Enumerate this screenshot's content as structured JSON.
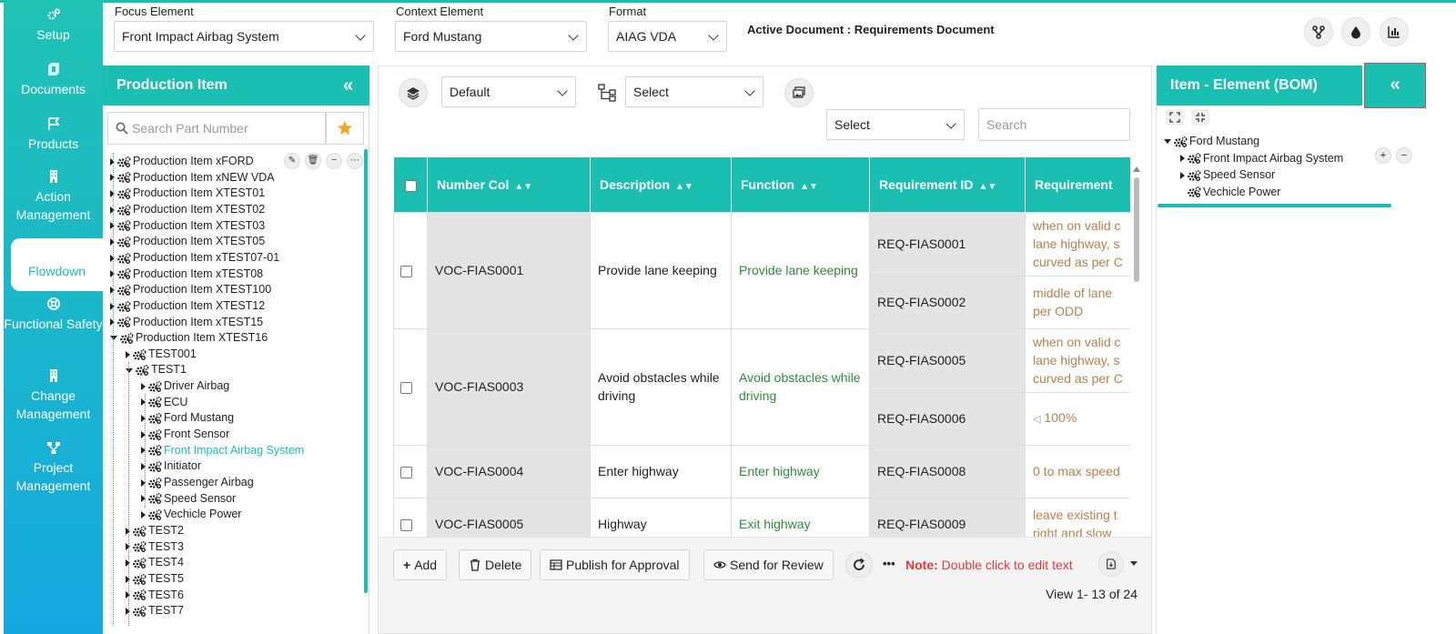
{
  "nav": {
    "items": [
      {
        "label": "Setup",
        "icon": "gears-icon"
      },
      {
        "label": "Documents",
        "icon": "copy-icon"
      },
      {
        "label": "Products",
        "icon": "flag-icon"
      },
      {
        "label": "Action Management",
        "icon": "building-icon"
      },
      {
        "label": "Flowdown",
        "icon": "building-icon",
        "active": true
      },
      {
        "label": "Functional Safety",
        "icon": "life-ring-icon"
      },
      {
        "label": "Change Management",
        "icon": "building-icon"
      },
      {
        "label": "Project Management",
        "icon": "sitemap-icon"
      }
    ]
  },
  "topbar": {
    "focus_label": "Focus Element",
    "focus_value": "Front Impact Airbag System",
    "context_label": "Context Element",
    "context_value": "Ford Mustang",
    "format_label": "Format",
    "format_value": "AIAG VDA",
    "active_document": "Active Document : Requirements Document"
  },
  "production": {
    "title": "Production Item",
    "collapse": "«",
    "search_placeholder": "Search Part Number",
    "tree": [
      {
        "label": "Production Item xFORD",
        "level": 0,
        "open": false
      },
      {
        "label": "Production Item xNEW VDA",
        "level": 0,
        "open": false
      },
      {
        "label": "Production Item XTEST01",
        "level": 0,
        "open": false
      },
      {
        "label": "Production Item XTEST02",
        "level": 0,
        "open": false
      },
      {
        "label": "Production Item XTEST03",
        "level": 0,
        "open": false
      },
      {
        "label": "Production Item XTEST05",
        "level": 0,
        "open": false
      },
      {
        "label": "Production Item xTEST07-01",
        "level": 0,
        "open": false
      },
      {
        "label": "Production Item xTEST08",
        "level": 0,
        "open": false
      },
      {
        "label": "Production Item XTEST100",
        "level": 0,
        "open": false
      },
      {
        "label": "Production Item XTEST12",
        "level": 0,
        "open": false
      },
      {
        "label": "Production Item xTEST15",
        "level": 0,
        "open": false
      },
      {
        "label": "Production Item XTEST16",
        "level": 0,
        "open": true
      },
      {
        "label": "TEST001",
        "level": 1,
        "open": false
      },
      {
        "label": "TEST1",
        "level": 1,
        "open": true
      },
      {
        "label": "Driver Airbag",
        "level": 2,
        "open": false
      },
      {
        "label": "ECU",
        "level": 2,
        "open": false
      },
      {
        "label": "Ford Mustang",
        "level": 2,
        "open": false
      },
      {
        "label": "Front Sensor",
        "level": 2,
        "open": false
      },
      {
        "label": "Front Impact Airbag System",
        "level": 2,
        "open": false,
        "highlight": true
      },
      {
        "label": "Initiator",
        "level": 2,
        "open": false
      },
      {
        "label": "Passenger Airbag",
        "level": 2,
        "open": false
      },
      {
        "label": "Speed Sensor",
        "level": 2,
        "open": false
      },
      {
        "label": "Vechicle Power",
        "level": 2,
        "open": false
      },
      {
        "label": "TEST2",
        "level": 1,
        "open": false
      },
      {
        "label": "TEST3",
        "level": 1,
        "open": false
      },
      {
        "label": "TEST4",
        "level": 1,
        "open": false
      },
      {
        "label": "TEST5",
        "level": 1,
        "open": false
      },
      {
        "label": "TEST6",
        "level": 1,
        "open": false
      },
      {
        "label": "TEST7",
        "level": 1,
        "open": false
      }
    ]
  },
  "main": {
    "view_select": "Default",
    "flow_select": "Select",
    "filter_select": "Select",
    "search_placeholder": "Search",
    "columns": [
      "Number Col",
      "Description",
      "Function",
      "Requirement ID",
      "Requirement"
    ],
    "rows": [
      {
        "number": "VOC-FIAS0001",
        "description": "Provide lane keeping",
        "function": "Provide lane keeping",
        "reqs": [
          {
            "id": "REQ-FIAS0001",
            "lines": [
              "when on valid c",
              "lane highway, s",
              "curved as per C"
            ]
          },
          {
            "id": "REQ-FIAS0002",
            "lines": [
              "middle of lane",
              "per ODD"
            ]
          }
        ]
      },
      {
        "number": "VOC-FIAS0003",
        "description": "Avoid obstacles while driving",
        "function": "Avoid obstacles while driving",
        "reqs": [
          {
            "id": "REQ-FIAS0005",
            "lines": [
              "when on valid c",
              "lane highway, s",
              "curved as per C"
            ]
          },
          {
            "id": "REQ-FIAS0006",
            "lines": [
              "100%"
            ]
          }
        ]
      },
      {
        "number": "VOC-FIAS0004",
        "description": "Enter highway",
        "function": "Enter highway",
        "reqs": [
          {
            "id": "REQ-FIAS0008",
            "lines": [
              "0 to max speed"
            ]
          }
        ]
      },
      {
        "number": "VOC-FIAS0005",
        "description": "Highway",
        "function": "Exit highway",
        "reqs": [
          {
            "id": "REQ-FIAS0009",
            "lines": [
              "leave existing t",
              "right and slow"
            ]
          }
        ]
      }
    ],
    "footer": {
      "add": "Add",
      "delete": "Delete",
      "publish": "Publish for Approval",
      "review": "Send for Review",
      "more": "•••",
      "note_label": "Note:",
      "note_text": "Double click to edit text",
      "view_count": "View 1- 13 of 24"
    }
  },
  "bom": {
    "title": "Item - Element (BOM)",
    "collapse": "«",
    "tree": [
      {
        "label": "Ford Mustang",
        "level": 0
      },
      {
        "label": "Front Impact Airbag System",
        "level": 1
      },
      {
        "label": "Speed Sensor",
        "level": 1
      },
      {
        "label": "Vechicle Power",
        "level": 1
      }
    ]
  },
  "colors": {
    "accent": "#1bbfb2",
    "function_text": "#2e8b3c",
    "requirement_text": "#b8804a",
    "note": "#e03a3a"
  }
}
